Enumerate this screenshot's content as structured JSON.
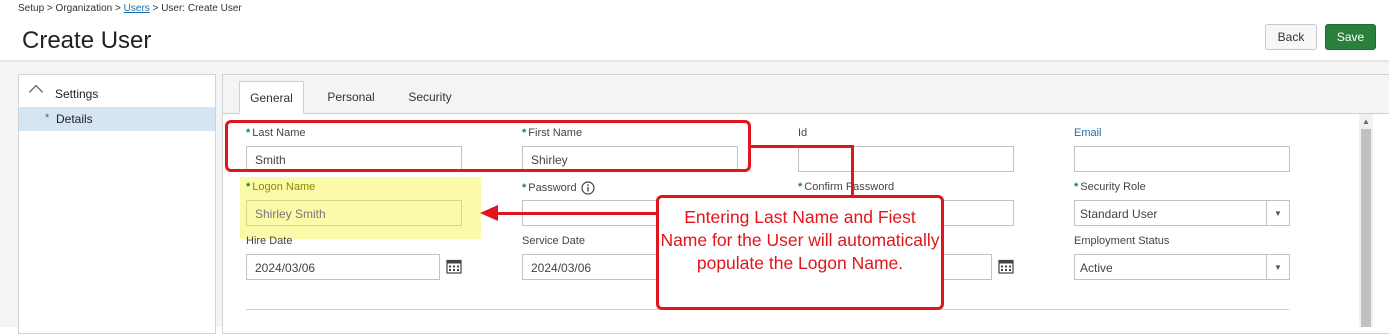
{
  "breadcrumb": {
    "setup": "Setup",
    "sep1": " > ",
    "organization": "Organization",
    "sep2": " > ",
    "users": "Users",
    "sep3": " > ",
    "current": "User: Create User"
  },
  "page": {
    "title": "Create User"
  },
  "actions": {
    "back_label": "Back",
    "save_label": "Save"
  },
  "sidebar": {
    "section_label": "Settings",
    "items": [
      {
        "label": "Details",
        "marker": "*"
      }
    ]
  },
  "tabs": [
    {
      "label": "General",
      "active": true
    },
    {
      "label": "Personal",
      "active": false
    },
    {
      "label": "Security",
      "active": false
    }
  ],
  "form": {
    "last_name": {
      "label": "Last Name",
      "required": "*",
      "value": "Smith"
    },
    "first_name": {
      "label": "First Name",
      "required": "*",
      "value": "Shirley"
    },
    "id": {
      "label": "Id",
      "value": ""
    },
    "email": {
      "label": "Email",
      "value": ""
    },
    "logon_name": {
      "label": "Logon Name",
      "required": "*",
      "value": "Shirley Smith"
    },
    "password": {
      "label": "Password",
      "required": "*",
      "info_icon": "info-icon",
      "value": ""
    },
    "confirm_password": {
      "label": "Confirm Password",
      "required": "*",
      "value": ""
    },
    "security_role": {
      "label": "Security Role",
      "required": "*",
      "value": "Standard User"
    },
    "hire_date": {
      "label": "Hire Date",
      "value": "2024/03/06"
    },
    "service_date": {
      "label": "Service Date",
      "value": "2024/03/06"
    },
    "employment_status": {
      "label": "Employment Status",
      "value": "Active"
    }
  },
  "annotation": {
    "callout_text": "Entering Last Name and Fiest Name for the User will automatically populate the Logon Name."
  },
  "colors": {
    "accent_green": "#2a7f3a",
    "annotation_red": "#e0161c",
    "highlight_yellow": "#fbfaa8",
    "link_blue": "#1a6fa8"
  }
}
